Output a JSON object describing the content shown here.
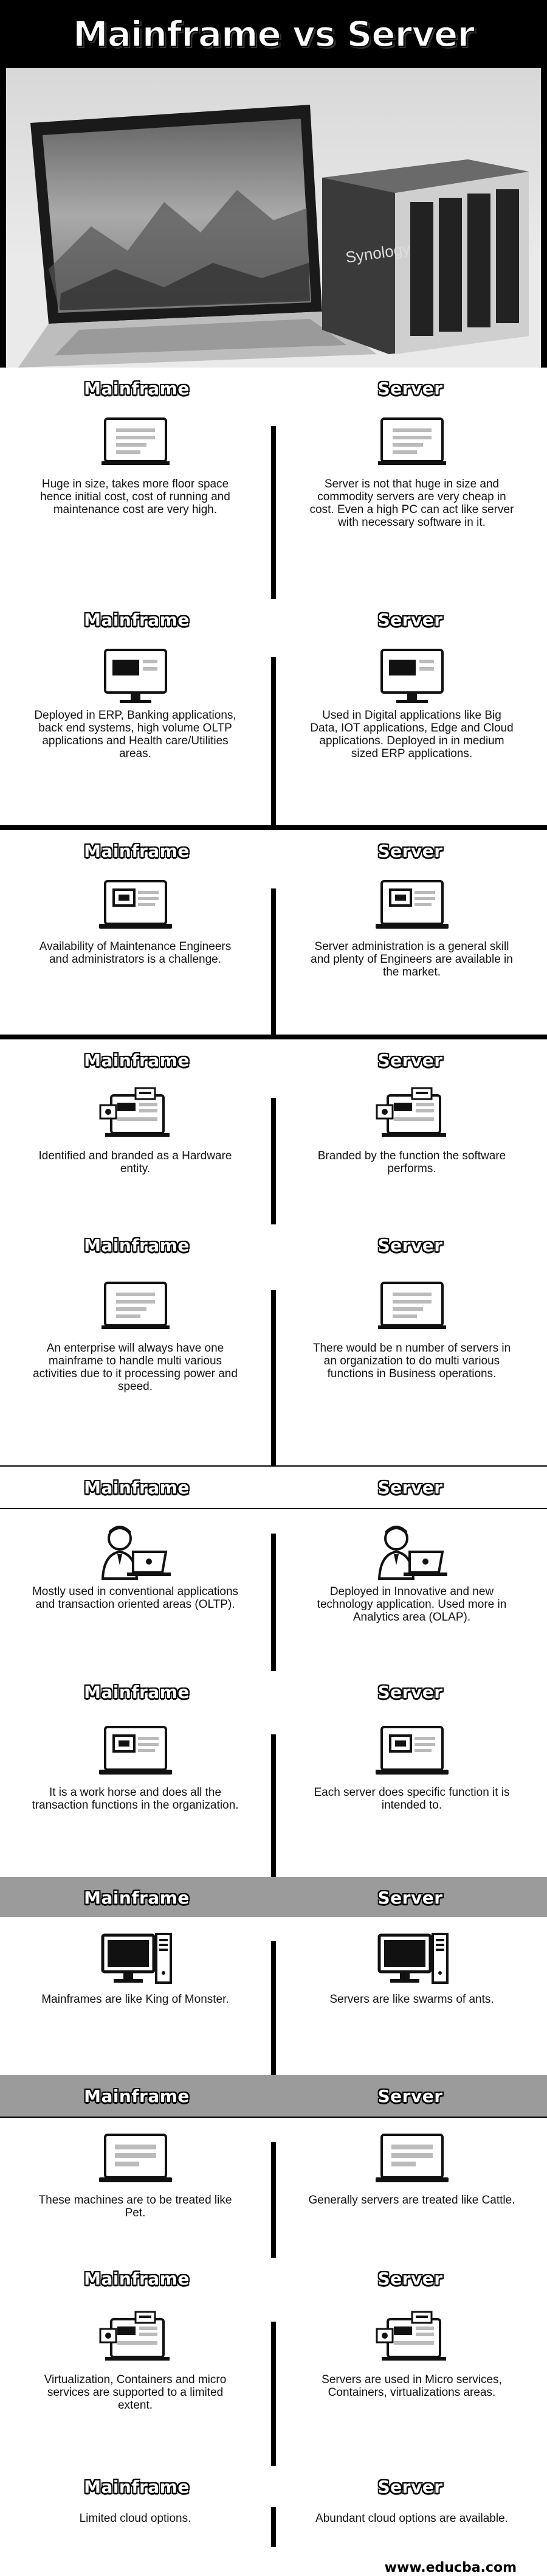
{
  "title": "Mainframe vs Server",
  "column_headers": {
    "left": "Mainframe",
    "right": "Server"
  },
  "rows": [
    {
      "icon": "monitor-doc-icon",
      "left": "Huge in size, takes more floor space hence initial cost, cost of running and maintenance cost are very high.",
      "right": "Server is not that huge in size and commodity servers are very cheap in cost. Even a high PC can act like server with necessary software in it."
    },
    {
      "icon": "desktop-monitor-icon",
      "left": "Deployed in ERP, Banking applications, back end systems, high volume OLTP applications and Health care/Utilities areas.",
      "right": "Used in Digital applications like Big Data, IOT applications, Edge and Cloud applications. Deployed in in medium sized ERP applications."
    },
    {
      "icon": "laptop-icon",
      "left": "Availability of Maintenance Engineers and administrators is a challenge.",
      "right": "Server administration is a general skill and plenty of Engineers are available in the market."
    },
    {
      "icon": "analytics-monitor-icon",
      "left": "Identified and branded as a Hardware entity.",
      "right": "Branded by the function the software performs."
    },
    {
      "icon": "monitor-doc-icon",
      "left": "An enterprise will always have one mainframe to handle multi various activities due to it processing power and speed.",
      "right": "There would be n number of servers in an organization to do multi various functions in Business operations."
    },
    {
      "icon": "person-laptop-icon",
      "left": "Mostly used in conventional applications and transaction oriented areas (OLTP).",
      "right": "Deployed in Innovative and new technology application. Used more in Analytics area (OLAP)."
    },
    {
      "icon": "laptop-icon",
      "left": "It is a work horse and does all the transaction functions in the organization.",
      "right": "Each server does specific function it is intended to."
    },
    {
      "icon": "desktop-tower-icon",
      "left": "Mainframes are like King of Monster.",
      "right": "Servers are like swarms of ants."
    },
    {
      "icon": "laptop-doc-icon",
      "left": "These machines are to be treated like Pet.",
      "right": "Generally servers are treated like Cattle."
    },
    {
      "icon": "analytics-monitor-icon",
      "left": "Virtualization, Containers and micro services are supported to a limited extent.",
      "right": "Servers are used in Micro services, Containers, virtualizations areas."
    },
    {
      "icon": "",
      "left": "Limited cloud options.",
      "right": "Abundant cloud options are available."
    }
  ],
  "footer_url": "www.educba.com",
  "colors": {
    "background": "#000000",
    "panel": "#ffffff",
    "gray_header": "#9b9b9b"
  }
}
